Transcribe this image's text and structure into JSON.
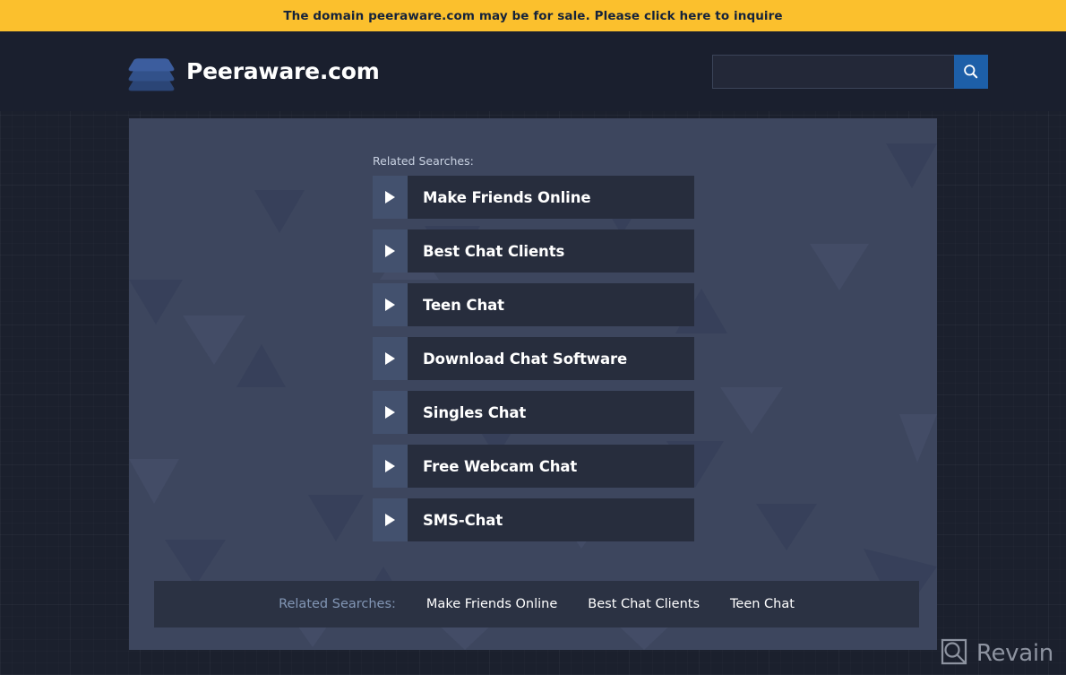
{
  "banner": {
    "text": "The domain peeraware.com may be for sale. Please click here to inquire",
    "bg_color": "#fbc02d",
    "text_color": "#15233b"
  },
  "header": {
    "brand_name": "Peeraware.com",
    "logo_icon": "stacked-layers-icon",
    "bg_color": "#1a1f2e"
  },
  "search": {
    "value": "",
    "placeholder": "",
    "button_icon": "search-icon",
    "button_color": "#1d5fa8"
  },
  "main": {
    "related_label": "Related Searches:",
    "bg_color": "#3d465e",
    "results": [
      {
        "label": "Make Friends Online",
        "icon": "play-arrow-icon"
      },
      {
        "label": "Best Chat Clients",
        "icon": "play-arrow-icon"
      },
      {
        "label": "Teen Chat",
        "icon": "play-arrow-icon"
      },
      {
        "label": "Download Chat Software",
        "icon": "play-arrow-icon"
      },
      {
        "label": "Singles Chat",
        "icon": "play-arrow-icon"
      },
      {
        "label": "Free Webcam Chat",
        "icon": "play-arrow-icon"
      },
      {
        "label": "SMS-Chat",
        "icon": "play-arrow-icon"
      }
    ]
  },
  "footer": {
    "label": "Related Searches:",
    "links": [
      "Make Friends Online",
      "Best Chat Clients",
      "Teen Chat"
    ]
  },
  "watermark": {
    "text": "Revain",
    "icon": "revain-logo-icon"
  }
}
